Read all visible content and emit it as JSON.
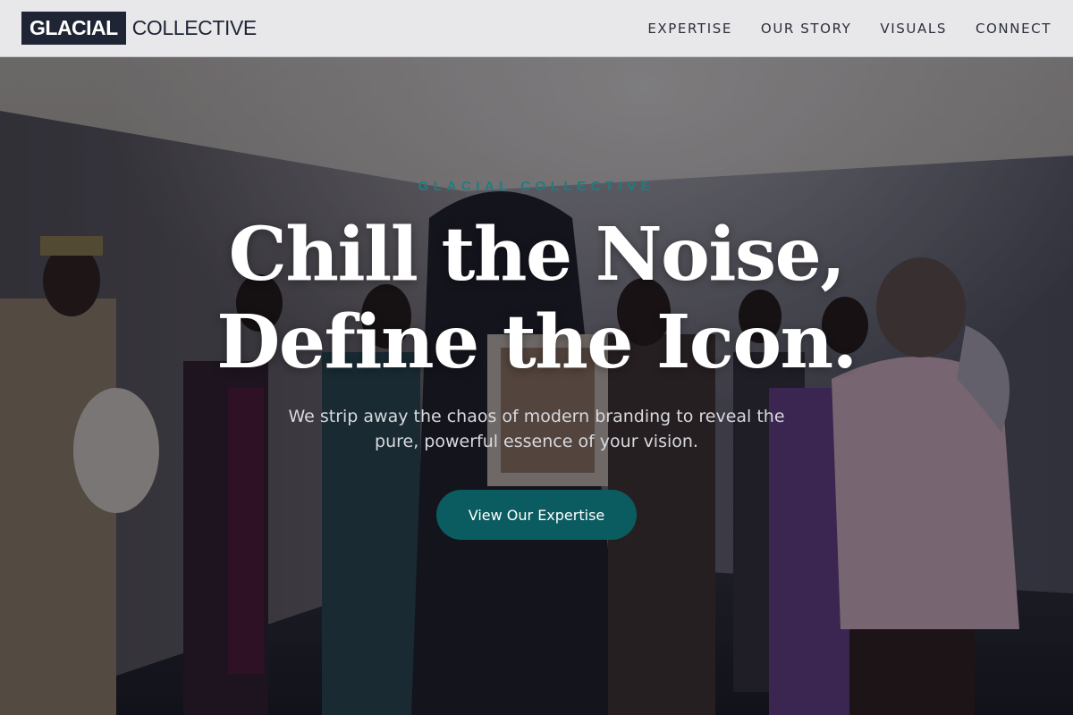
{
  "brand": {
    "logo_box_text": "GLACIAL",
    "logo_text": "COLLECTIVE"
  },
  "nav": {
    "items": [
      {
        "label": "EXPERTISE"
      },
      {
        "label": "OUR STORY"
      },
      {
        "label": "VISUALS"
      },
      {
        "label": "CONNECT"
      }
    ]
  },
  "hero": {
    "eyebrow": "GLACIAL COLLECTIVE",
    "headline_line1": "Chill the Noise,",
    "headline_line2": "Define the Icon.",
    "subtext": "We strip away the chaos of modern branding to reveal the pure, powerful essence of your vision.",
    "cta_label": "View Our Expertise"
  },
  "colors": {
    "accent": "#0b5c60",
    "eyebrow": "#1f7d80",
    "brand_dark": "#1f2535",
    "header_bg": "#e8e8eb"
  },
  "icons": {
    "hero_background": "fashion-crowd-photo"
  }
}
